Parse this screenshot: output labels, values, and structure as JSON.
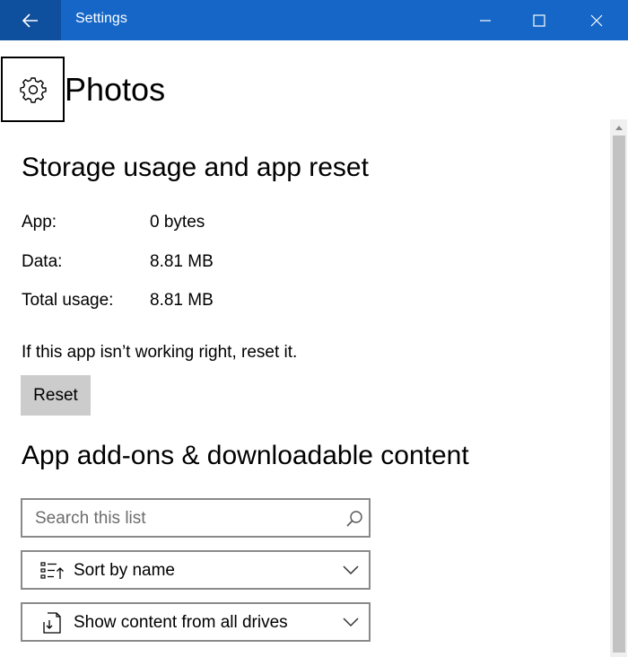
{
  "window": {
    "title": "Settings",
    "accent": "#1566c7",
    "back_bg": "#0e4f9e"
  },
  "header": {
    "title": "Photos",
    "icon": "gear-icon"
  },
  "storage": {
    "heading": "Storage usage and app reset",
    "rows": [
      {
        "label": "App:",
        "value": "0 bytes"
      },
      {
        "label": "Data:",
        "value": "8.81 MB"
      },
      {
        "label": "Total usage:",
        "value": "8.81 MB"
      }
    ],
    "reset_hint": "If this app isn’t working right, reset it.",
    "reset_label": "Reset"
  },
  "addons": {
    "heading": "App add-ons & downloadable content",
    "search": {
      "placeholder": "Search this list",
      "value": ""
    },
    "sort": {
      "label": "Sort by name",
      "icon": "sort-list-icon"
    },
    "filter": {
      "label": "Show content from all drives",
      "icon": "drive-icon"
    }
  }
}
